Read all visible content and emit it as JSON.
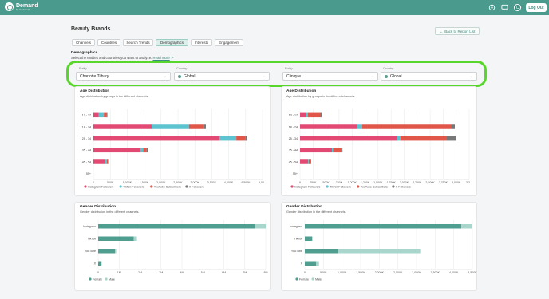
{
  "app": {
    "logo_title": "Demand",
    "logo_sub": "by Grubstack",
    "avatar_initial": "C",
    "logout_label": "Log Out"
  },
  "page": {
    "title": "Beauty Brands",
    "back_label": "Back to Report List"
  },
  "tabs": [
    "Channels",
    "Countries",
    "Search Trends",
    "Demographics",
    "Interests",
    "Engagement"
  ],
  "active_tab": "Demographics",
  "section": {
    "title": "Demographics",
    "description": "Select the entities and countries you want to analyze.",
    "link_label": "Read more"
  },
  "selectors": [
    {
      "entity_label": "Entity",
      "entity": "Charlotte Tilbury",
      "country_label": "Country",
      "country": "Global"
    },
    {
      "entity_label": "Entity",
      "entity": "Clinique",
      "country_label": "Country",
      "country": "Global"
    }
  ],
  "colors": {
    "instagram": "#e24a74",
    "tiktok": "#5ec3d0",
    "youtube": "#e0574a",
    "x": "#777777",
    "female": "#4f9e8f",
    "male": "#a9d6cc",
    "brand": "#4a9b8e"
  },
  "age_cards": [
    {
      "title": "Age Distribution",
      "description": "Age distribution by groups in the different channels.",
      "chart_data": {
        "type": "bar",
        "orientation": "horizontal",
        "stacked": true,
        "categories": [
          "13 - 17",
          "18 - 24",
          "25 - 34",
          "35 - 44",
          "45 - 54",
          "55+"
        ],
        "series": [
          {
            "name": "Instagram Followers",
            "values": [
              320000,
              3450000,
              7450000,
              2800000,
              700000,
              0
            ]
          },
          {
            "name": "TikTok Followers",
            "values": [
              300000,
              2200000,
              1000000,
              150000,
              100000,
              0
            ]
          },
          {
            "name": "YouTube Subscribers",
            "values": [
              150000,
              900000,
              550000,
              200000,
              60000,
              0
            ]
          },
          {
            "name": "X Followers",
            "values": [
              60000,
              100000,
              100000,
              60000,
              20000,
              0
            ]
          }
        ],
        "xlim": [
          0,
          10000000
        ],
        "ticks": [
          "0",
          "500K",
          "1,000K",
          "1,500K",
          "2,000K",
          "2,500K",
          "3,000K",
          "3,500K",
          "4,000K",
          "4,500K",
          "5,00..."
        ]
      }
    },
    {
      "title": "Age Distribution",
      "description": "Age distribution by groups in the different channels.",
      "chart_data": {
        "type": "bar",
        "orientation": "horizontal",
        "stacked": true,
        "categories": [
          "13 - 17",
          "18 - 24",
          "25 - 34",
          "35 - 44",
          "45 - 54",
          "55+"
        ],
        "series": [
          {
            "name": "Instagram Followers",
            "values": [
              200000,
              1800000,
              3050000,
              1000000,
              250000,
              0
            ]
          },
          {
            "name": "TikTok Followers",
            "values": [
              50000,
              150000,
              100000,
              30000,
              20000,
              0
            ]
          },
          {
            "name": "YouTube Subscribers",
            "values": [
              400000,
              2800000,
              1450000,
              250000,
              60000,
              0
            ]
          },
          {
            "name": "X Followers",
            "values": [
              30000,
              100000,
              300000,
              50000,
              20000,
              0
            ]
          }
        ],
        "xlim": [
          0,
          5300000
        ],
        "ticks": [
          "0",
          "250K",
          "500K",
          "750K",
          "1,000K",
          "1,250K",
          "1,500K",
          "1,750K",
          "2,000K",
          "2,250K",
          "2,500K",
          "2,750K",
          "3,000K",
          "3,2..."
        ]
      }
    }
  ],
  "gender_cards": [
    {
      "title": "Gender Distribution",
      "description": "Gender distribution in the different channels.",
      "chart_data": {
        "type": "bar",
        "orientation": "horizontal",
        "stacked": true,
        "categories": [
          "Instagram",
          "TikTok",
          "YouTube",
          "X"
        ],
        "series": [
          {
            "name": "Female",
            "values": [
              7500000,
              1700000,
              800000,
              150000
            ]
          },
          {
            "name": "Male",
            "values": [
              500000,
              150000,
              60000,
              20000
            ]
          }
        ],
        "xlim": [
          0,
          8000000
        ],
        "ticks": [
          "0",
          "1M",
          "2M",
          "3M",
          "4M",
          "5M",
          "6M",
          "7M",
          "8M"
        ]
      }
    },
    {
      "title": "Gender Distribution",
      "description": "Gender distribution in the different channels.",
      "chart_data": {
        "type": "bar",
        "orientation": "horizontal",
        "stacked": true,
        "categories": [
          "Instagram",
          "TikTok",
          "YouTube",
          "X"
        ],
        "series": [
          {
            "name": "Female",
            "values": [
              4200000,
              200000,
              900000,
              300000
            ]
          },
          {
            "name": "Male",
            "values": [
              300000,
              0,
              2200000,
              80000
            ]
          }
        ],
        "xlim": [
          0,
          4500000
        ],
        "ticks": [
          "0",
          "500K",
          "1,000K",
          "1,500K",
          "2,000K",
          "2,500K",
          "3,000K",
          "3,500K",
          "4,000K",
          "4,500K"
        ]
      }
    }
  ]
}
